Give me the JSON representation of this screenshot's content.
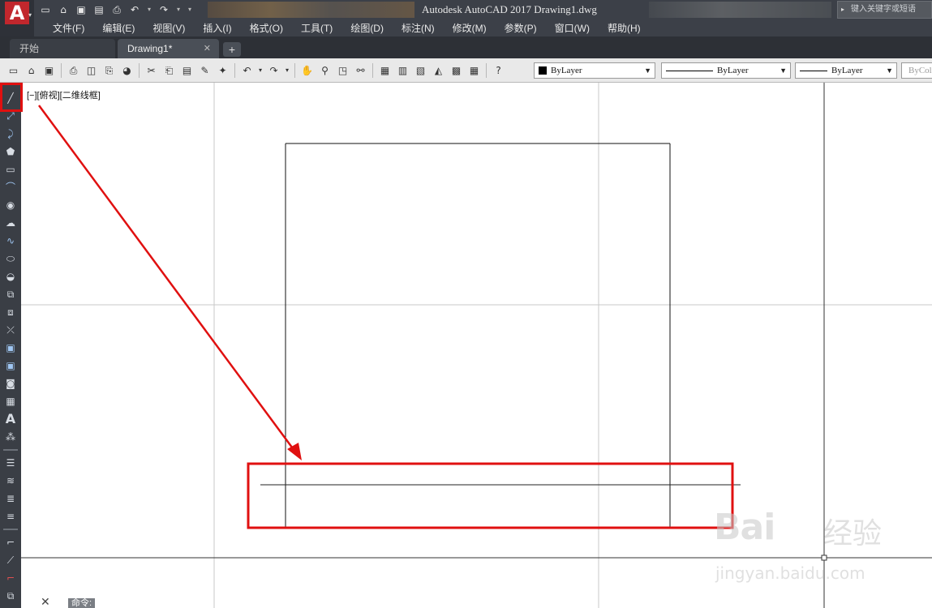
{
  "window": {
    "title": "Autodesk AutoCAD 2017    Drawing1.dwg",
    "search_placeholder": "键入关键字或短语",
    "app_letter": "A"
  },
  "menu": {
    "items": [
      {
        "label": "文件(F)",
        "id": "file"
      },
      {
        "label": "编辑(E)",
        "id": "edit"
      },
      {
        "label": "视图(V)",
        "id": "view"
      },
      {
        "label": "插入(I)",
        "id": "insert"
      },
      {
        "label": "格式(O)",
        "id": "format"
      },
      {
        "label": "工具(T)",
        "id": "tools"
      },
      {
        "label": "绘图(D)",
        "id": "draw"
      },
      {
        "label": "标注(N)",
        "id": "dimension"
      },
      {
        "label": "修改(M)",
        "id": "modify"
      },
      {
        "label": "参数(P)",
        "id": "parametric"
      },
      {
        "label": "窗口(W)",
        "id": "window"
      },
      {
        "label": "帮助(H)",
        "id": "help"
      }
    ]
  },
  "tabs": {
    "start": "开始",
    "drawing": "Drawing1*",
    "close": "✕",
    "add": "+"
  },
  "properties": {
    "color": "ByLayer",
    "linetype": "ByLayer",
    "lineweight": "ByLayer",
    "plotstyle": "ByColor"
  },
  "viewport": {
    "label": "[−][俯视][二维线框]"
  },
  "command": {
    "prompt": "命令:"
  },
  "watermark": {
    "brand": "Bai",
    "brand_suffix": "经验",
    "url": "jingyan.baidu.com"
  },
  "colors": {
    "titlebar": "#3c4048",
    "highlight": "#e01010",
    "canvas": "#ffffff",
    "autocad_red": "#c1272d"
  },
  "icons": {
    "left_toolbar": [
      "line-icon",
      "construction-line-icon",
      "polyline-icon",
      "polygon-icon",
      "rectangle-icon",
      "arc-icon",
      "circle-icon",
      "revision-cloud-icon",
      "spline-icon",
      "ellipse-icon",
      "ellipse-arc-icon",
      "insert-block-icon",
      "make-block-icon",
      "point-icon",
      "hatch-icon",
      "gradient-icon",
      "region-icon",
      "table-icon",
      "text-icon",
      "add-selected-icon"
    ]
  }
}
